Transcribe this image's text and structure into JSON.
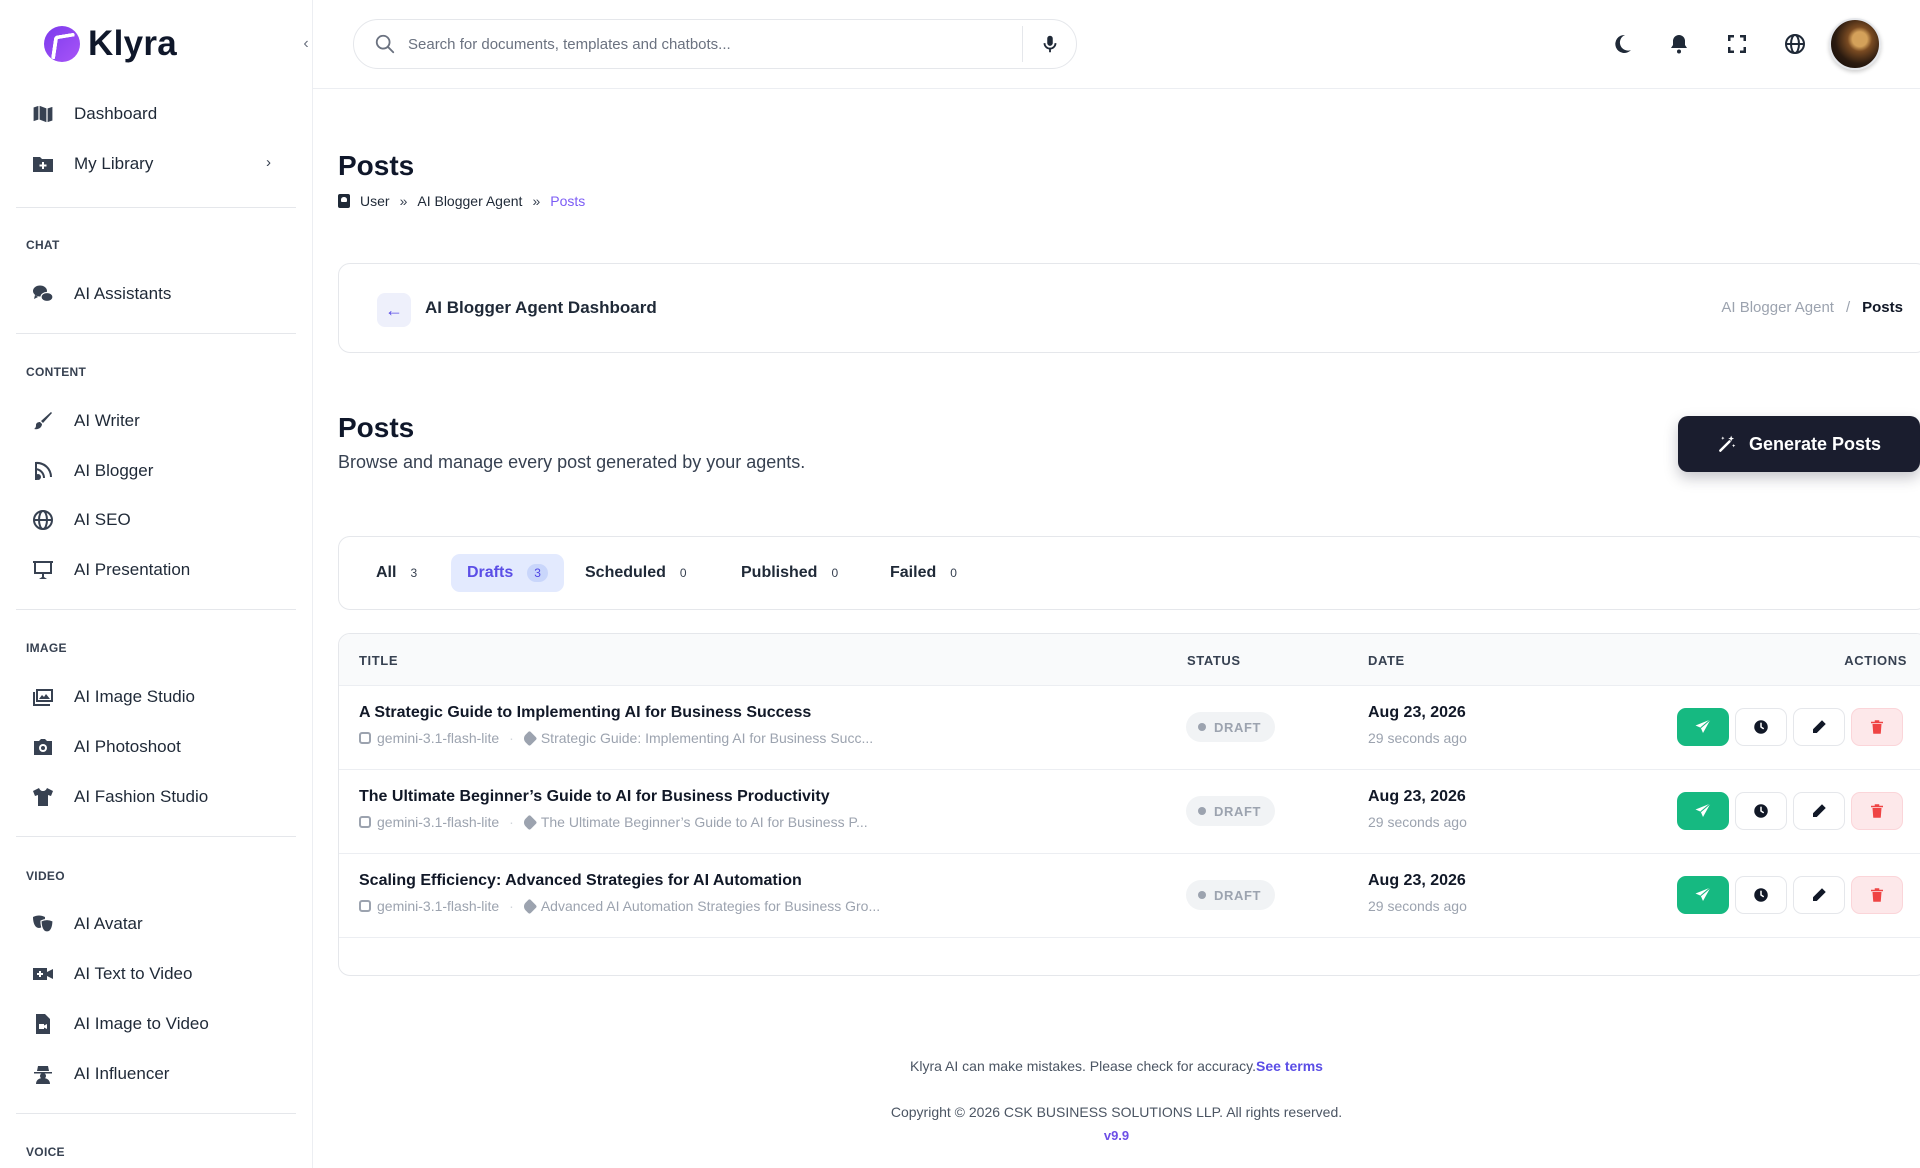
{
  "app": {
    "name": "Klyra"
  },
  "search": {
    "placeholder": "Search for documents, templates and chatbots..."
  },
  "sidebar": {
    "top": [
      {
        "label": "Dashboard",
        "icon": "map-icon"
      },
      {
        "label": "My Library",
        "icon": "folder-plus-icon"
      }
    ],
    "sections": [
      {
        "label": "CHAT",
        "items": [
          {
            "label": "AI Assistants",
            "icon": "chat-bubbles-icon"
          }
        ]
      },
      {
        "label": "CONTENT",
        "items": [
          {
            "label": "AI Writer",
            "icon": "brush-icon"
          },
          {
            "label": "AI Blogger",
            "icon": "blog-icon"
          },
          {
            "label": "AI SEO",
            "icon": "globe-icon"
          },
          {
            "label": "AI Presentation",
            "icon": "presentation-icon"
          }
        ]
      },
      {
        "label": "IMAGE",
        "items": [
          {
            "label": "AI Image Studio",
            "icon": "images-icon"
          },
          {
            "label": "AI Photoshoot",
            "icon": "camera-icon"
          },
          {
            "label": "AI Fashion Studio",
            "icon": "shirt-icon"
          }
        ]
      },
      {
        "label": "VIDEO",
        "items": [
          {
            "label": "AI Avatar",
            "icon": "masks-icon"
          },
          {
            "label": "AI Text to Video",
            "icon": "video-plus-icon"
          },
          {
            "label": "AI Image to Video",
            "icon": "file-video-icon"
          },
          {
            "label": "AI Influencer",
            "icon": "user-secret-icon"
          }
        ]
      },
      {
        "label": "VOICE",
        "items": []
      }
    ]
  },
  "header": {
    "title": "Posts",
    "breadcrumb": [
      "User",
      "AI Blogger Agent",
      "Posts"
    ]
  },
  "agent_nav": {
    "title": "AI Blogger Agent Dashboard",
    "crumb_parent": "AI Blogger Agent",
    "crumb_sep": "/",
    "crumb_current": "Posts"
  },
  "posts_section": {
    "title": "Posts",
    "subtitle": "Browse and manage every post generated by your agents.",
    "generate_label": "Generate Posts"
  },
  "tabs": [
    {
      "label": "All",
      "count": "3",
      "active": false
    },
    {
      "label": "Drafts",
      "count": "3",
      "active": true
    },
    {
      "label": "Scheduled",
      "count": "0",
      "active": false
    },
    {
      "label": "Published",
      "count": "0",
      "active": false
    },
    {
      "label": "Failed",
      "count": "0",
      "active": false
    }
  ],
  "table": {
    "columns": [
      "TITLE",
      "STATUS",
      "DATE",
      "ACTIONS"
    ],
    "rows": [
      {
        "title": "A Strategic Guide to Implementing AI for Business Success",
        "model": "gemini-3.1-flash-lite",
        "keyword": "Strategic Guide: Implementing AI for Business Succ...",
        "status": "DRAFT",
        "date": "Aug 23, 2026",
        "ago": "29 seconds ago"
      },
      {
        "title": "The Ultimate Beginner’s Guide to AI for Business Productivity",
        "model": "gemini-3.1-flash-lite",
        "keyword": "The Ultimate Beginner’s Guide to AI for Business P...",
        "status": "DRAFT",
        "date": "Aug 23, 2026",
        "ago": "29 seconds ago"
      },
      {
        "title": "Scaling Efficiency: Advanced Strategies for AI Automation",
        "model": "gemini-3.1-flash-lite",
        "keyword": "Advanced AI Automation Strategies for Business Gro...",
        "status": "DRAFT",
        "date": "Aug 23, 2026",
        "ago": "29 seconds ago"
      }
    ]
  },
  "footer": {
    "note": "Klyra AI can make mistakes. Please check for accuracy.",
    "terms": "See terms",
    "copyright": "Copyright © 2026 CSK BUSINESS SOLUTIONS LLP. All rights reserved.",
    "version": "v9.9"
  },
  "colors": {
    "accent": "#5b4ee6",
    "primary_dark": "#1a1d2e",
    "success": "#16b981",
    "danger": "#ef4444"
  }
}
